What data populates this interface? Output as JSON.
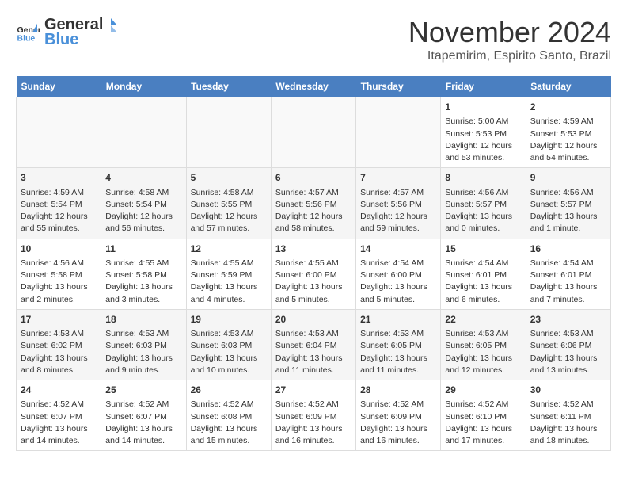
{
  "header": {
    "logo_general": "General",
    "logo_blue": "Blue",
    "month": "November 2024",
    "location": "Itapemirim, Espirito Santo, Brazil"
  },
  "weekdays": [
    "Sunday",
    "Monday",
    "Tuesday",
    "Wednesday",
    "Thursday",
    "Friday",
    "Saturday"
  ],
  "weeks": [
    [
      {
        "day": "",
        "info": ""
      },
      {
        "day": "",
        "info": ""
      },
      {
        "day": "",
        "info": ""
      },
      {
        "day": "",
        "info": ""
      },
      {
        "day": "",
        "info": ""
      },
      {
        "day": "1",
        "info": "Sunrise: 5:00 AM\nSunset: 5:53 PM\nDaylight: 12 hours\nand 53 minutes."
      },
      {
        "day": "2",
        "info": "Sunrise: 4:59 AM\nSunset: 5:53 PM\nDaylight: 12 hours\nand 54 minutes."
      }
    ],
    [
      {
        "day": "3",
        "info": "Sunrise: 4:59 AM\nSunset: 5:54 PM\nDaylight: 12 hours\nand 55 minutes."
      },
      {
        "day": "4",
        "info": "Sunrise: 4:58 AM\nSunset: 5:54 PM\nDaylight: 12 hours\nand 56 minutes."
      },
      {
        "day": "5",
        "info": "Sunrise: 4:58 AM\nSunset: 5:55 PM\nDaylight: 12 hours\nand 57 minutes."
      },
      {
        "day": "6",
        "info": "Sunrise: 4:57 AM\nSunset: 5:56 PM\nDaylight: 12 hours\nand 58 minutes."
      },
      {
        "day": "7",
        "info": "Sunrise: 4:57 AM\nSunset: 5:56 PM\nDaylight: 12 hours\nand 59 minutes."
      },
      {
        "day": "8",
        "info": "Sunrise: 4:56 AM\nSunset: 5:57 PM\nDaylight: 13 hours\nand 0 minutes."
      },
      {
        "day": "9",
        "info": "Sunrise: 4:56 AM\nSunset: 5:57 PM\nDaylight: 13 hours\nand 1 minute."
      }
    ],
    [
      {
        "day": "10",
        "info": "Sunrise: 4:56 AM\nSunset: 5:58 PM\nDaylight: 13 hours\nand 2 minutes."
      },
      {
        "day": "11",
        "info": "Sunrise: 4:55 AM\nSunset: 5:58 PM\nDaylight: 13 hours\nand 3 minutes."
      },
      {
        "day": "12",
        "info": "Sunrise: 4:55 AM\nSunset: 5:59 PM\nDaylight: 13 hours\nand 4 minutes."
      },
      {
        "day": "13",
        "info": "Sunrise: 4:55 AM\nSunset: 6:00 PM\nDaylight: 13 hours\nand 5 minutes."
      },
      {
        "day": "14",
        "info": "Sunrise: 4:54 AM\nSunset: 6:00 PM\nDaylight: 13 hours\nand 5 minutes."
      },
      {
        "day": "15",
        "info": "Sunrise: 4:54 AM\nSunset: 6:01 PM\nDaylight: 13 hours\nand 6 minutes."
      },
      {
        "day": "16",
        "info": "Sunrise: 4:54 AM\nSunset: 6:01 PM\nDaylight: 13 hours\nand 7 minutes."
      }
    ],
    [
      {
        "day": "17",
        "info": "Sunrise: 4:53 AM\nSunset: 6:02 PM\nDaylight: 13 hours\nand 8 minutes."
      },
      {
        "day": "18",
        "info": "Sunrise: 4:53 AM\nSunset: 6:03 PM\nDaylight: 13 hours\nand 9 minutes."
      },
      {
        "day": "19",
        "info": "Sunrise: 4:53 AM\nSunset: 6:03 PM\nDaylight: 13 hours\nand 10 minutes."
      },
      {
        "day": "20",
        "info": "Sunrise: 4:53 AM\nSunset: 6:04 PM\nDaylight: 13 hours\nand 11 minutes."
      },
      {
        "day": "21",
        "info": "Sunrise: 4:53 AM\nSunset: 6:05 PM\nDaylight: 13 hours\nand 11 minutes."
      },
      {
        "day": "22",
        "info": "Sunrise: 4:53 AM\nSunset: 6:05 PM\nDaylight: 13 hours\nand 12 minutes."
      },
      {
        "day": "23",
        "info": "Sunrise: 4:53 AM\nSunset: 6:06 PM\nDaylight: 13 hours\nand 13 minutes."
      }
    ],
    [
      {
        "day": "24",
        "info": "Sunrise: 4:52 AM\nSunset: 6:07 PM\nDaylight: 13 hours\nand 14 minutes."
      },
      {
        "day": "25",
        "info": "Sunrise: 4:52 AM\nSunset: 6:07 PM\nDaylight: 13 hours\nand 14 minutes."
      },
      {
        "day": "26",
        "info": "Sunrise: 4:52 AM\nSunset: 6:08 PM\nDaylight: 13 hours\nand 15 minutes."
      },
      {
        "day": "27",
        "info": "Sunrise: 4:52 AM\nSunset: 6:09 PM\nDaylight: 13 hours\nand 16 minutes."
      },
      {
        "day": "28",
        "info": "Sunrise: 4:52 AM\nSunset: 6:09 PM\nDaylight: 13 hours\nand 16 minutes."
      },
      {
        "day": "29",
        "info": "Sunrise: 4:52 AM\nSunset: 6:10 PM\nDaylight: 13 hours\nand 17 minutes."
      },
      {
        "day": "30",
        "info": "Sunrise: 4:52 AM\nSunset: 6:11 PM\nDaylight: 13 hours\nand 18 minutes."
      }
    ]
  ]
}
